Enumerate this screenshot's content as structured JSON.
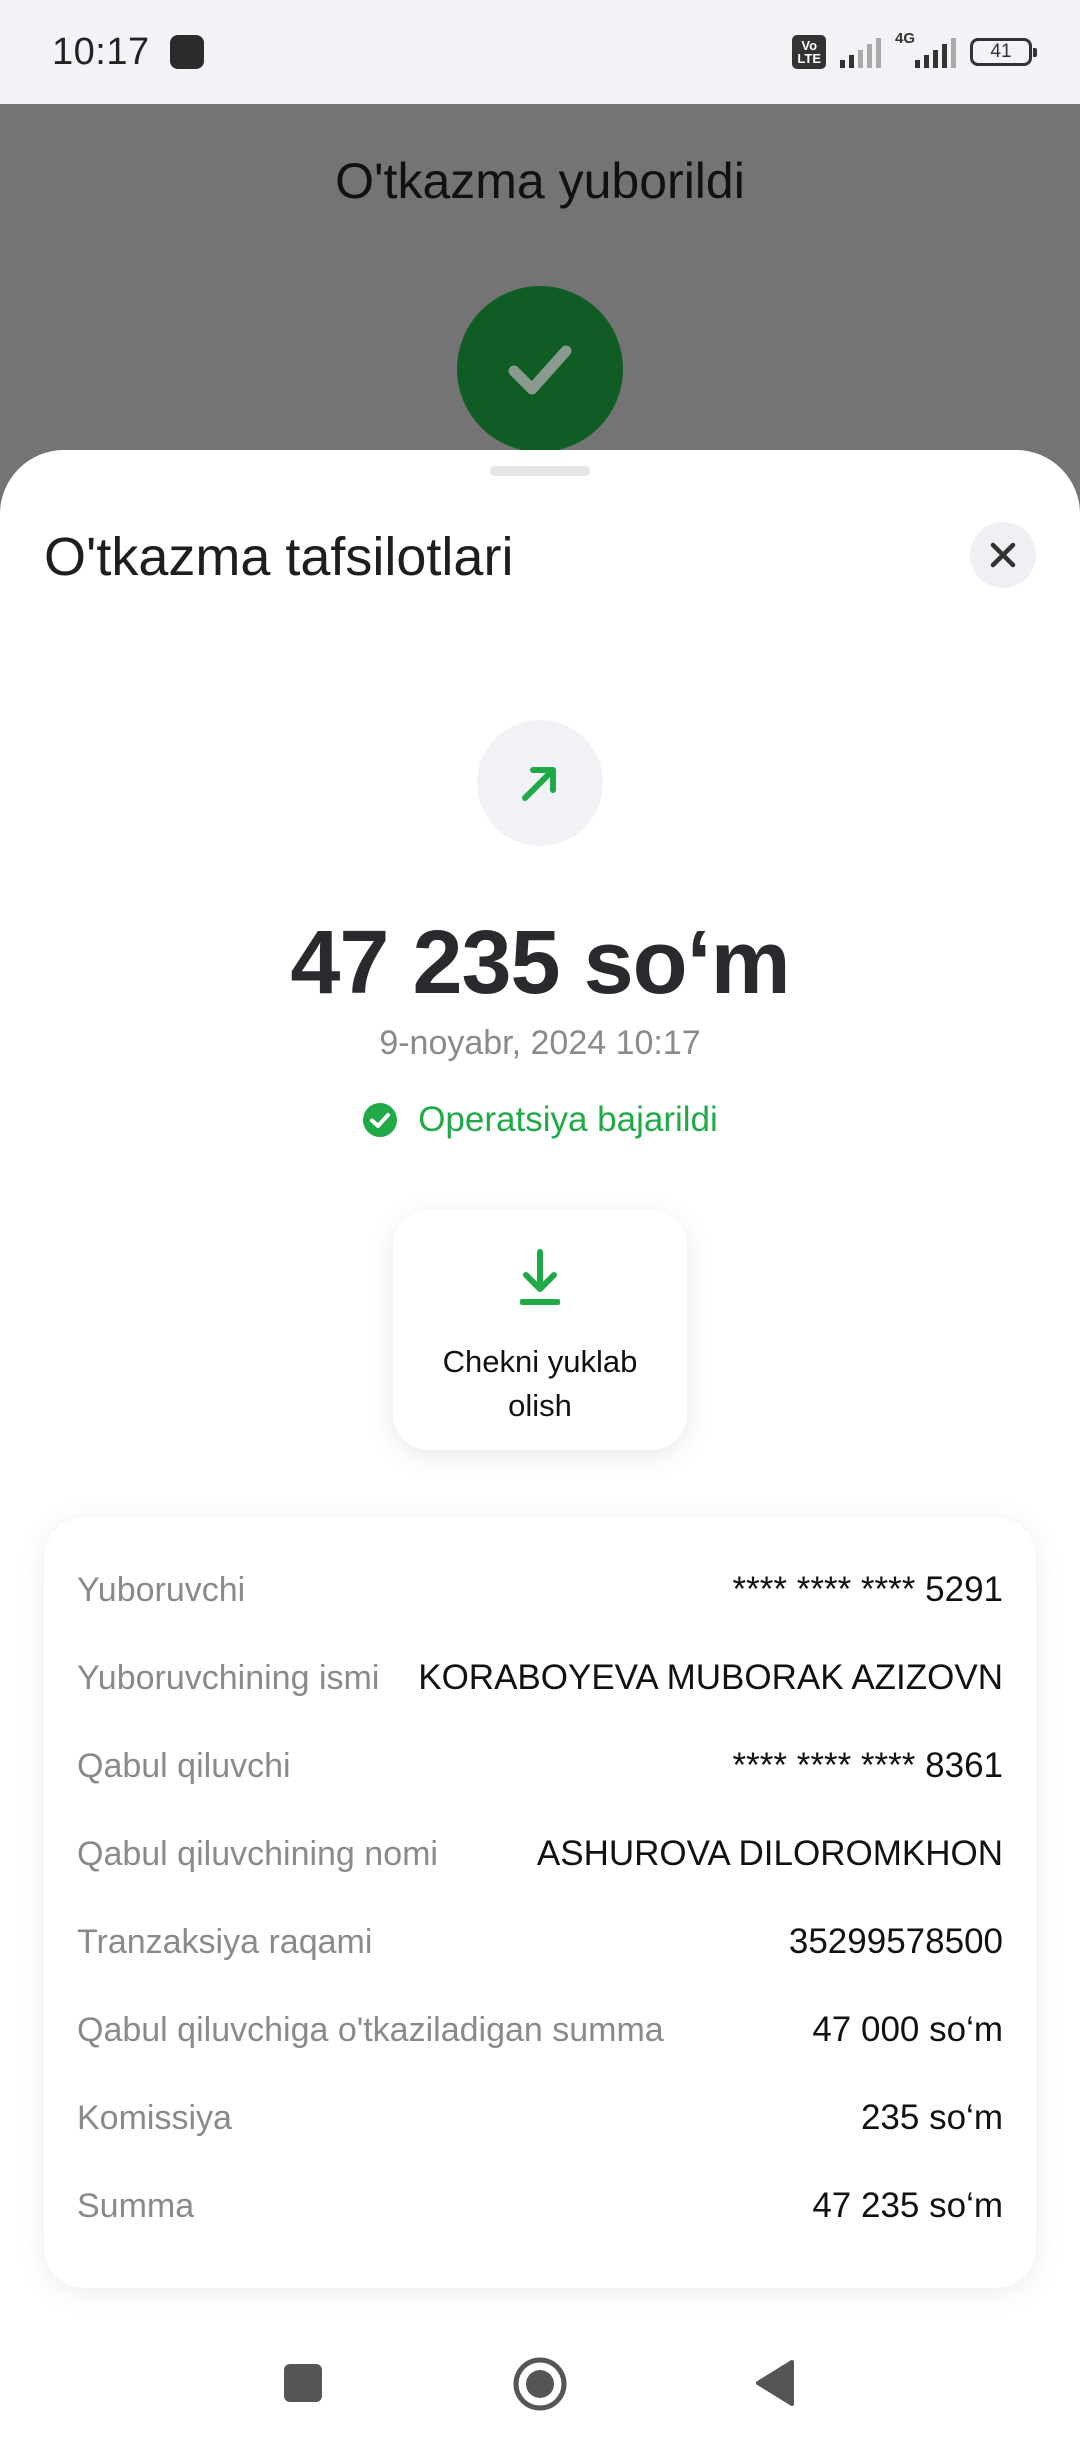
{
  "status_bar": {
    "time": "10:17",
    "volte": "Vo LTE",
    "network": "4G",
    "battery": "41"
  },
  "background": {
    "title": "O'tkazma yuborildi",
    "success_icon": "check-icon",
    "success_color": "#0f5c25"
  },
  "sheet": {
    "title": "O'tkazma tafsilotlari",
    "close_icon": "close-icon",
    "direction_icon": "arrow-up-right-icon",
    "amount": "47 235 so‘m",
    "datetime": "9-noyabr, 2024 10:17",
    "status_text": "Operatsiya bajarildi",
    "status_color": "#1faa47",
    "receipt_button": {
      "icon": "download-icon",
      "label": "Chekni yuklab olish"
    },
    "details": [
      {
        "key": "Yuboruvchi",
        "value": "**** **** **** 5291"
      },
      {
        "key": "Yuboruvchining ismi",
        "value": "KORABOYEVA MUBORAK AZIZOVN"
      },
      {
        "key": "Qabul qiluvchi",
        "value": "**** **** **** 8361"
      },
      {
        "key": "Qabul qiluvchining nomi",
        "value": "ASHUROVA DILOROMKHON"
      },
      {
        "key": "Tranzaksiya raqami",
        "value": "35299578500"
      },
      {
        "key": "Qabul qiluvchiga o'tkaziladigan summa",
        "value": "47 000 so‘m"
      },
      {
        "key": "Komissiya",
        "value": "235 so‘m"
      },
      {
        "key": "Summa",
        "value": "47 235 so‘m"
      }
    ]
  },
  "nav_bar": {
    "recents_icon": "square-icon",
    "home_icon": "circle-home-icon",
    "back_icon": "triangle-back-icon"
  }
}
